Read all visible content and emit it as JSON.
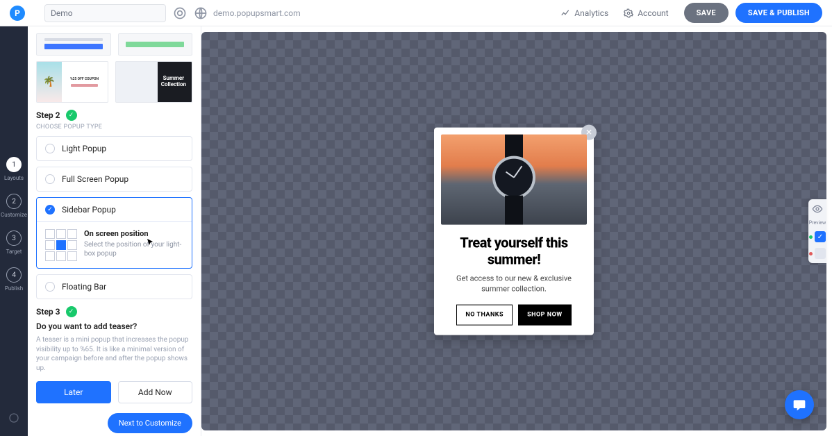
{
  "app": {
    "title": "Demo",
    "url": "demo.popupsmart.com"
  },
  "header": {
    "analytics": "Analytics",
    "account": "Account",
    "save": "SAVE",
    "save_publish": "SAVE & PUBLISH"
  },
  "rail": [
    {
      "num": "1",
      "label": "Layouts",
      "active": true
    },
    {
      "num": "2",
      "label": "Customize",
      "active": false
    },
    {
      "num": "3",
      "label": "Target",
      "active": false
    },
    {
      "num": "4",
      "label": "Publish",
      "active": false
    }
  ],
  "templates": {
    "summer_label": "Summer\nCollection"
  },
  "step2": {
    "title": "Step 2",
    "sub": "CHOOSE POPUP TYPE",
    "options": [
      "Light Popup",
      "Full Screen Popup",
      "Sidebar Popup",
      "Floating Bar"
    ],
    "selectedIndex": 2,
    "pos_title": "On screen position",
    "pos_desc": "Select the position of your light-box popup"
  },
  "step3": {
    "title": "Step 3"
  },
  "teaser": {
    "q": "Do you want to add teaser?",
    "desc": "A teaser is a mini popup that increases the popup visibility up to %65. It is like a minimal version of your campaign before and after the popup shows up.",
    "later": "Later",
    "add": "Add Now"
  },
  "next": "Next to Customize",
  "popup": {
    "title": "Treat yourself this summer!",
    "body": "Get access to our new & exclusive summer collection.",
    "no": "NO THANKS",
    "shop": "SHOP NOW"
  },
  "dock": {
    "preview": "Preview"
  },
  "colors": {
    "primary": "#1f72ff",
    "success": "#18c96b"
  }
}
